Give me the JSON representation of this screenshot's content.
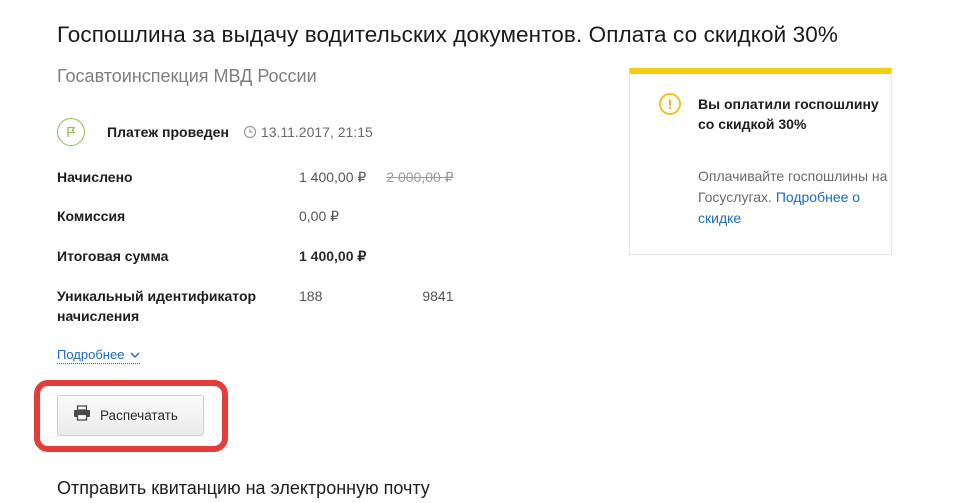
{
  "header": {
    "title": "Госпошлина за выдачу водительских документов. Оплата со скидкой 30%",
    "subtitle": "Госавтоинспекция МВД России"
  },
  "status": {
    "label": "Платеж проведен",
    "datetime": "13.11.2017, 21:15",
    "color": "#8fbf54"
  },
  "details": {
    "charged_label": "Начислено",
    "charged_value": "1 400,00 ₽",
    "charged_original": "2 000,00 ₽",
    "commission_label": "Комиссия",
    "commission_value": "0,00 ₽",
    "total_label": "Итоговая сумма",
    "total_value": "1 400,00 ₽",
    "uid_label_line1": "Уникальный идентификатор",
    "uid_label_line2": "начисления",
    "uid_prefix": "188",
    "uid_suffix": "9841"
  },
  "more_link": "Подробнее",
  "print_button": "Распечатать",
  "email_section_title": "Отправить квитанцию на электронную почту",
  "info_box": {
    "title": "Вы оплатили госпошлину со скидкой 30%",
    "text": "Оплачивайте госпошлины на Госуслугах. ",
    "link": "Подробнее о скидке",
    "accent_color": "#f2d00f"
  },
  "highlight_color": "#e33d3a"
}
